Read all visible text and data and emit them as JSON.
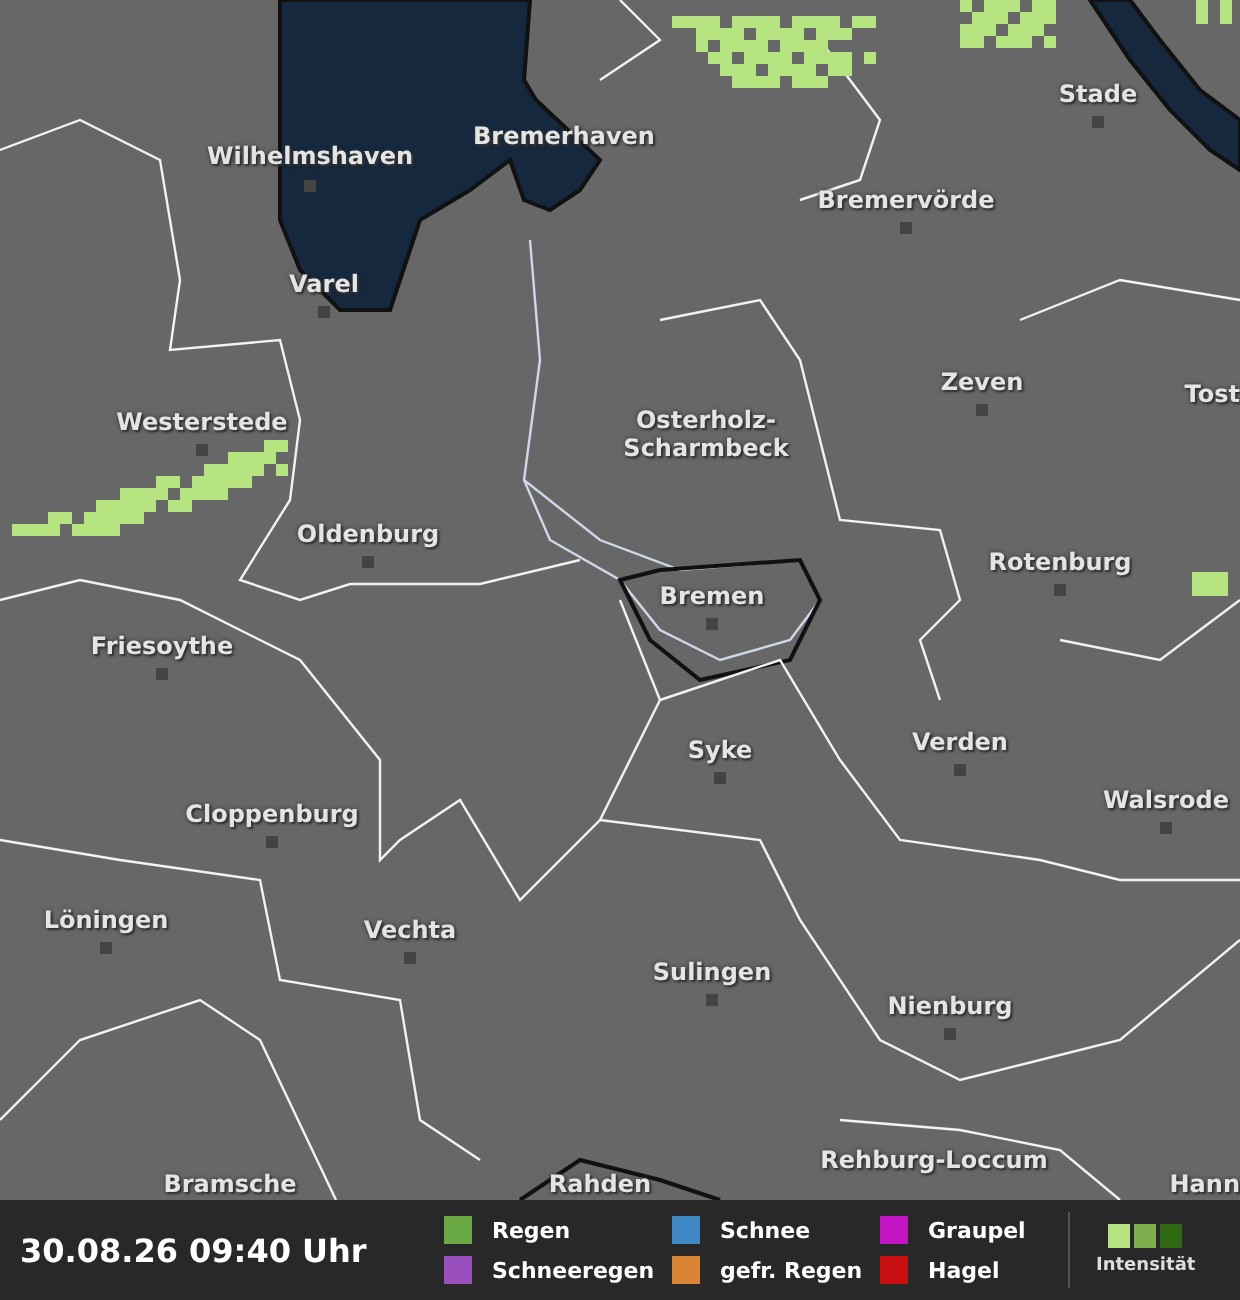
{
  "cities": [
    {
      "name": "Wilhelmshaven"
    },
    {
      "name": "Bremerhaven"
    },
    {
      "name": "Stade"
    },
    {
      "name": "Bremervörde"
    },
    {
      "name": "Varel"
    },
    {
      "name": "Zeven"
    },
    {
      "name": "Tost"
    },
    {
      "name": "Westerstede"
    },
    {
      "name": "Osterholz-Scharmbeck"
    },
    {
      "name": "Oldenburg"
    },
    {
      "name": "Rotenburg"
    },
    {
      "name": "Bremen"
    },
    {
      "name": "Friesoythe"
    },
    {
      "name": "Syke"
    },
    {
      "name": "Verden"
    },
    {
      "name": "Walsrode"
    },
    {
      "name": "Cloppenburg"
    },
    {
      "name": "Löningen"
    },
    {
      "name": "Vechta"
    },
    {
      "name": "Sulingen"
    },
    {
      "name": "Nienburg"
    },
    {
      "name": "Rehburg-Loccum"
    },
    {
      "name": "Bramsche"
    },
    {
      "name": "Rahden"
    },
    {
      "name": "Hann"
    }
  ],
  "legend": {
    "timestamp": "30.08.26 09:40 Uhr",
    "types": [
      {
        "label": "Regen",
        "color": "#6aa843"
      },
      {
        "label": "Schneeregen",
        "color": "#9a4fbf"
      },
      {
        "label": "Schnee",
        "color": "#3f88c5"
      },
      {
        "label": "gefr. Regen",
        "color": "#d98535"
      },
      {
        "label": "Graupel",
        "color": "#c415c4"
      },
      {
        "label": "Hagel",
        "color": "#c80e0e"
      }
    ],
    "intensity": {
      "label": "Intensität",
      "steps": [
        {
          "color": "#b5e37f"
        },
        {
          "color": "#7fae4f"
        },
        {
          "color": "#2f6a12"
        }
      ]
    }
  }
}
